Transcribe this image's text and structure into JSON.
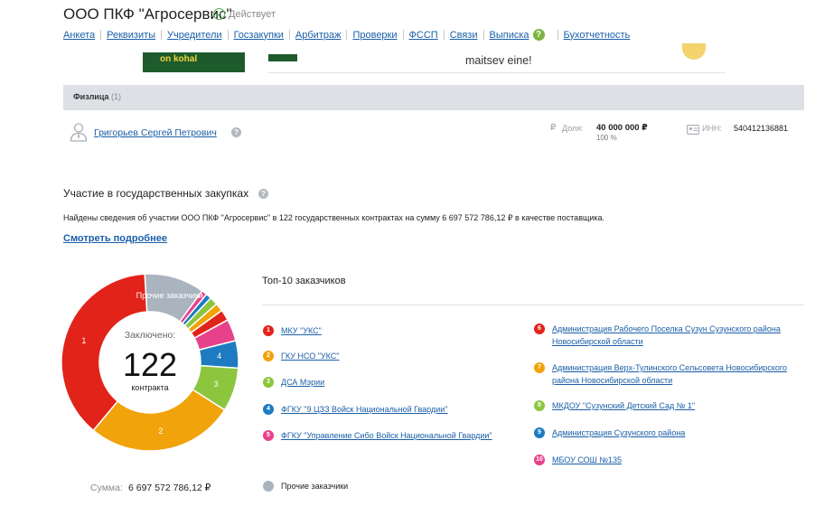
{
  "header": {
    "company_name": "ООО ПКФ \"Агросервис\"",
    "status": "Действует",
    "nav": [
      "Анкета",
      "Реквизиты",
      "Учредители",
      "Госзакупки",
      "Арбитраж",
      "Проверки",
      "ФССП",
      "Связи",
      "Выписка",
      "Бухотчетность"
    ]
  },
  "banner": {
    "image_text": "on kohal",
    "text": "maitsev eine!"
  },
  "individuals": {
    "section_title": "Физлица",
    "count": "(1)",
    "person": {
      "name": "Григорьев Сергей Петрович",
      "share_label": "Доля:",
      "share_value": "40 000 000 ₽",
      "share_percent": "100 %",
      "inn_label": "ИНН:",
      "inn_value": "540412136881"
    }
  },
  "procurement": {
    "title": "Участие в государственных закупках",
    "description": "Найдены сведения об участии ООО ПКФ \"Агросервис\" в 122 государственных контрактах на сумму 6 697 572 786,12 ₽ в качестве поставщика.",
    "more_link": "Смотреть подробнее",
    "donut": {
      "label_top": "Заключено:",
      "count": "122",
      "label_bottom": "контракта"
    },
    "total_label": "Сумма:",
    "total_value": "6 697 572 786,12 ₽"
  },
  "top_customers": {
    "title": "Топ-10 заказчиков",
    "others_label": "Прочие заказчики",
    "others_color": "#aab4bf",
    "items": [
      {
        "num": "1",
        "name": "МКУ \"УКС\"",
        "color": "#e2231a"
      },
      {
        "num": "2",
        "name": "ГКУ НСО \"УКС\"",
        "color": "#f0a30a"
      },
      {
        "num": "3",
        "name": "ДСА Мэрии",
        "color": "#8cc63f"
      },
      {
        "num": "4",
        "name": "ФГКУ \"9 ЦЗЗ Войск Национальной Гвардии\"",
        "color": "#1e7bc1"
      },
      {
        "num": "5",
        "name": "ФГКУ \"Управление Сибо Войск Национальной Гвардии\"",
        "color": "#e8418c"
      },
      {
        "num": "6",
        "name": "Администрация Рабочего Поселка Сузун Сузунского района Новосибирской области",
        "color": "#e2231a"
      },
      {
        "num": "7",
        "name": "Администрация Верх-Тулинского Сельсовета Новосибирского района Новосибирской области",
        "color": "#f0a30a"
      },
      {
        "num": "8",
        "name": "МКДОУ \"Сузунский Детский Сад № 1\"",
        "color": "#8cc63f"
      },
      {
        "num": "9",
        "name": "Администрация Сузунского района",
        "color": "#1e7bc1"
      },
      {
        "num": "10",
        "name": "МБОУ СОШ №135",
        "color": "#e8418c"
      }
    ]
  },
  "chart_data": {
    "type": "pie",
    "categories": [
      "1",
      "2",
      "3",
      "4",
      "5",
      "6",
      "7",
      "8",
      "9",
      "10",
      "Прочие заказчики"
    ],
    "values": [
      38,
      27,
      8,
      5,
      4,
      2,
      1.5,
      1.5,
      1,
      1,
      11
    ],
    "colors": [
      "#e2231a",
      "#f0a30a",
      "#8cc63f",
      "#1e7bc1",
      "#e8418c",
      "#e2231a",
      "#f0a30a",
      "#8cc63f",
      "#1e7bc1",
      "#e8418c",
      "#aab4bf"
    ],
    "center_value": "122"
  }
}
